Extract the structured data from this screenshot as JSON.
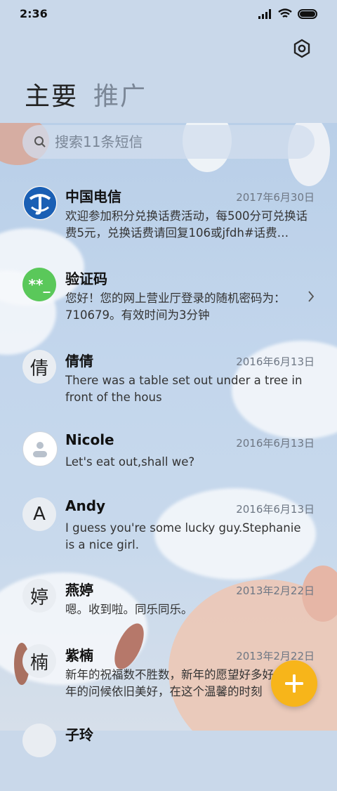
{
  "status": {
    "time": "2:36"
  },
  "tabs": [
    {
      "label": "主要"
    },
    {
      "label": "推广"
    }
  ],
  "search": {
    "placeholder": "搜索11条短信"
  },
  "messages": [
    {
      "name": "中国电信",
      "date": "2017年6月30日",
      "preview": "欢迎参加积分兑换话费活动，每500分可兑换话费5元，兑换话费请回复106或jfdh#话费…",
      "avatar": "telecom-logo"
    },
    {
      "name": "验证码",
      "date": "",
      "preview": "您好！您的网上营业厅登录的随机密码为：710679。有效时间为3分钟",
      "avatar_text": "**_"
    },
    {
      "name": "倩倩",
      "date": "2016年6月13日",
      "preview": "There was a table set out under a tree in front of the hous",
      "avatar_text": "倩"
    },
    {
      "name": "Nicole",
      "date": "2016年6月13日",
      "preview": "Let's eat out,shall we?",
      "avatar": "person-icon"
    },
    {
      "name": "Andy",
      "date": "2016年6月13日",
      "preview": "I guess you're some lucky guy.Stephanie is a nice girl.",
      "avatar_text": "A"
    },
    {
      "name": "燕婷",
      "date": "2013年2月22日",
      "preview": "嗯。收到啦。同乐同乐。",
      "avatar_text": "婷"
    },
    {
      "name": "紫楠",
      "date": "2013年2月22日",
      "preview": "新年的祝福数不胜数，新年的愿望好多好多，新年的问候依旧美好，在这个温馨的时刻",
      "avatar_text": "楠"
    },
    {
      "name": "子玲",
      "date": "",
      "preview": "",
      "avatar_text": ""
    }
  ],
  "colors": {
    "accent": "#f7b51a",
    "verify": "#5ac85a",
    "telecom": "#1a5fb4"
  }
}
